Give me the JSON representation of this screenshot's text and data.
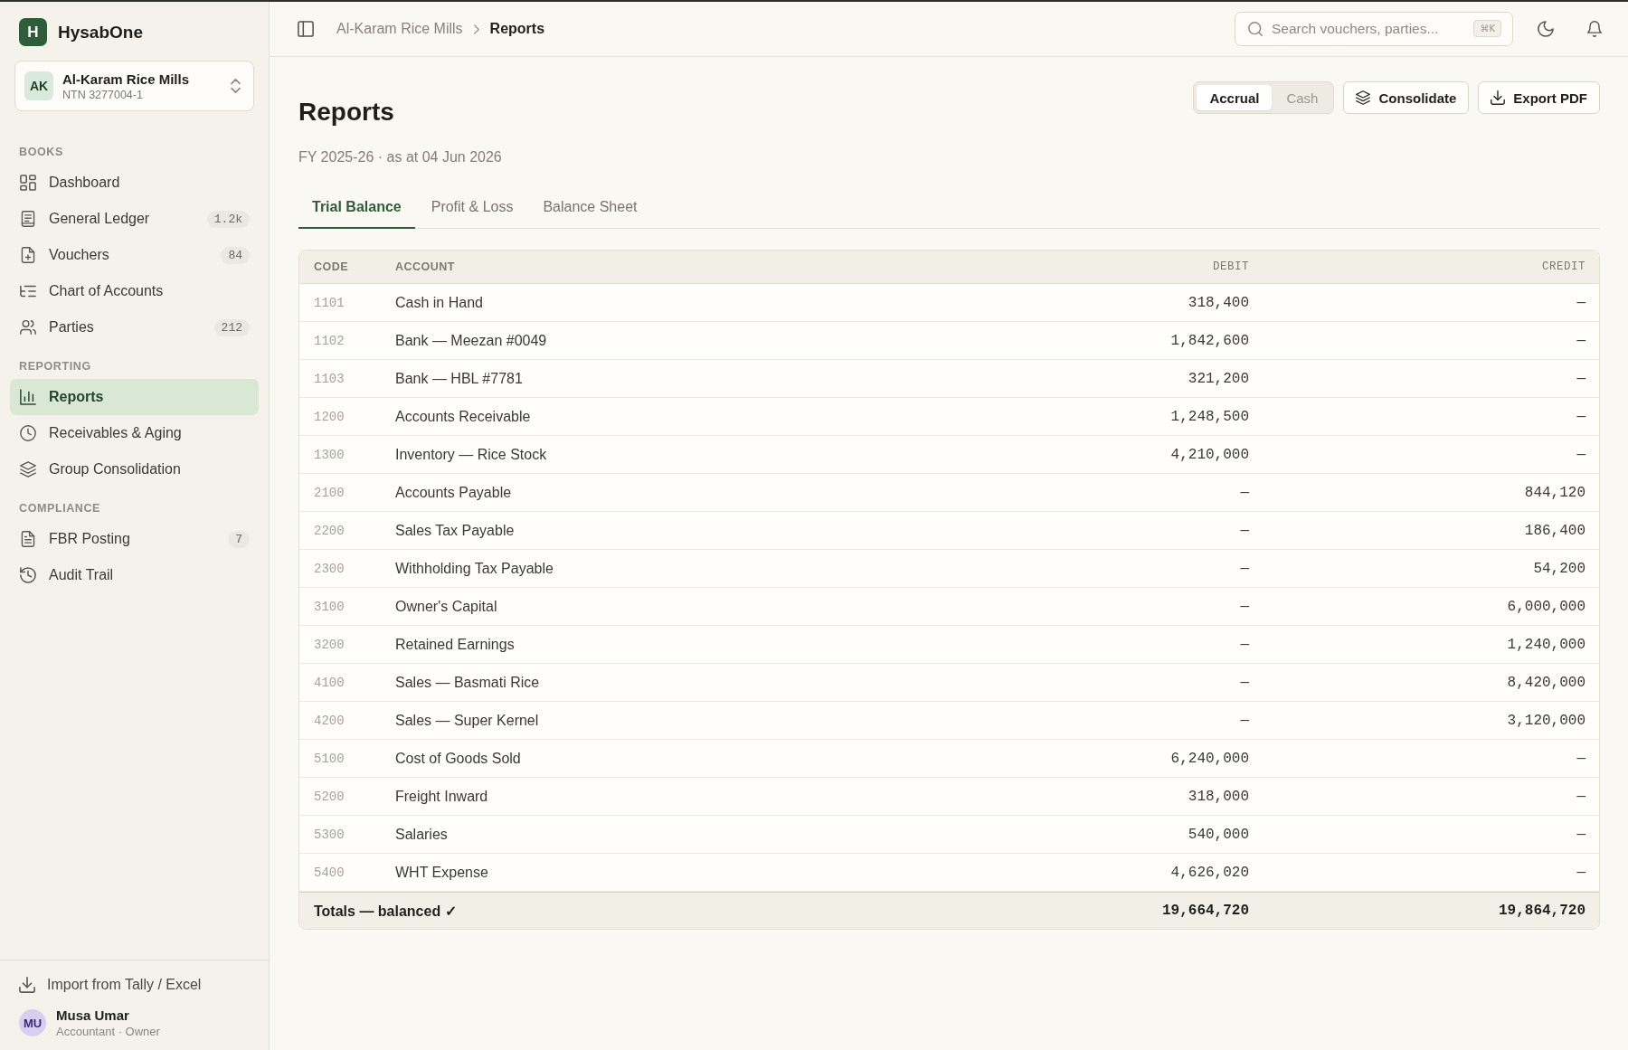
{
  "sidebar": {
    "brand": {
      "logo_letter": "H",
      "name": "HysabOne"
    },
    "organization": {
      "initials": "AK",
      "name": "Al-Karam Rice Mills",
      "tax_id": "NTN 3277004-1"
    },
    "sections": [
      {
        "heading": "BOOKS",
        "items": [
          {
            "label": "Dashboard",
            "selected": false
          },
          {
            "label": "General Ledger",
            "badge": "1.2k",
            "selected": false
          },
          {
            "label": "Vouchers",
            "badge": "84",
            "selected": false
          },
          {
            "label": "Chart of Accounts",
            "selected": false
          },
          {
            "label": "Parties",
            "badge": "212",
            "selected": false
          }
        ]
      },
      {
        "heading": "REPORTING",
        "items": [
          {
            "label": "Reports",
            "selected": true
          },
          {
            "label": "Receivables & Aging",
            "selected": false
          },
          {
            "label": "Group Consolidation",
            "selected": false
          }
        ]
      },
      {
        "heading": "COMPLIANCE",
        "items": [
          {
            "label": "FBR Posting",
            "badge": "7",
            "selected": false
          },
          {
            "label": "Audit Trail",
            "selected": false
          }
        ]
      }
    ],
    "footer": {
      "import_action": "Import from Tally / Excel",
      "user": {
        "initials": "MU",
        "name": "Musa Umar",
        "role": "Accountant · Owner"
      }
    }
  },
  "header": {
    "breadcrumb": [
      {
        "label": "Al-Karam Rice Mills",
        "current": false
      },
      {
        "label": "Reports",
        "current": true
      }
    ],
    "search": {
      "placeholder": "Search vouchers, parties...",
      "shortcut": "⌘K"
    }
  },
  "page": {
    "title": "Reports",
    "subtitle": "FY 2025-26 · as at 04 Jun 2026",
    "basis_toggle": [
      {
        "label": "Accrual",
        "selected": true
      },
      {
        "label": "Cash",
        "selected": false
      }
    ],
    "actions": [
      {
        "label": "Consolidate"
      },
      {
        "label": "Export PDF"
      }
    ],
    "tabs": [
      {
        "label": "Trial Balance",
        "selected": true
      },
      {
        "label": "Profit & Loss",
        "selected": false
      },
      {
        "label": "Balance Sheet",
        "selected": false
      }
    ],
    "table": {
      "columns": [
        "CODE",
        "ACCOUNT",
        "DEBIT",
        "CREDIT"
      ],
      "rows": [
        {
          "code": "1101",
          "account": "Cash in Hand",
          "debit": "318,400",
          "credit": "—"
        },
        {
          "code": "1102",
          "account": "Bank — Meezan #0049",
          "debit": "1,842,600",
          "credit": "—"
        },
        {
          "code": "1103",
          "account": "Bank — HBL #7781",
          "debit": "321,200",
          "credit": "—"
        },
        {
          "code": "1200",
          "account": "Accounts Receivable",
          "debit": "1,248,500",
          "credit": "—"
        },
        {
          "code": "1300",
          "account": "Inventory — Rice Stock",
          "debit": "4,210,000",
          "credit": "—"
        },
        {
          "code": "2100",
          "account": "Accounts Payable",
          "debit": "—",
          "credit": "844,120"
        },
        {
          "code": "2200",
          "account": "Sales Tax Payable",
          "debit": "—",
          "credit": "186,400"
        },
        {
          "code": "2300",
          "account": "Withholding Tax Payable",
          "debit": "—",
          "credit": "54,200"
        },
        {
          "code": "3100",
          "account": "Owner's Capital",
          "debit": "—",
          "credit": "6,000,000"
        },
        {
          "code": "3200",
          "account": "Retained Earnings",
          "debit": "—",
          "credit": "1,240,000"
        },
        {
          "code": "4100",
          "account": "Sales — Basmati Rice",
          "debit": "—",
          "credit": "8,420,000"
        },
        {
          "code": "4200",
          "account": "Sales — Super Kernel",
          "debit": "—",
          "credit": "3,120,000"
        },
        {
          "code": "5100",
          "account": "Cost of Goods Sold",
          "debit": "6,240,000",
          "credit": "—"
        },
        {
          "code": "5200",
          "account": "Freight Inward",
          "debit": "318,000",
          "credit": "—"
        },
        {
          "code": "5300",
          "account": "Salaries",
          "debit": "540,000",
          "credit": "—"
        },
        {
          "code": "5400",
          "account": "WHT Expense",
          "debit": "4,626,020",
          "credit": "—"
        }
      ],
      "totals": {
        "label": "Totals — balanced ✓",
        "debit": "19,664,720",
        "credit": "19,864,720"
      }
    }
  }
}
